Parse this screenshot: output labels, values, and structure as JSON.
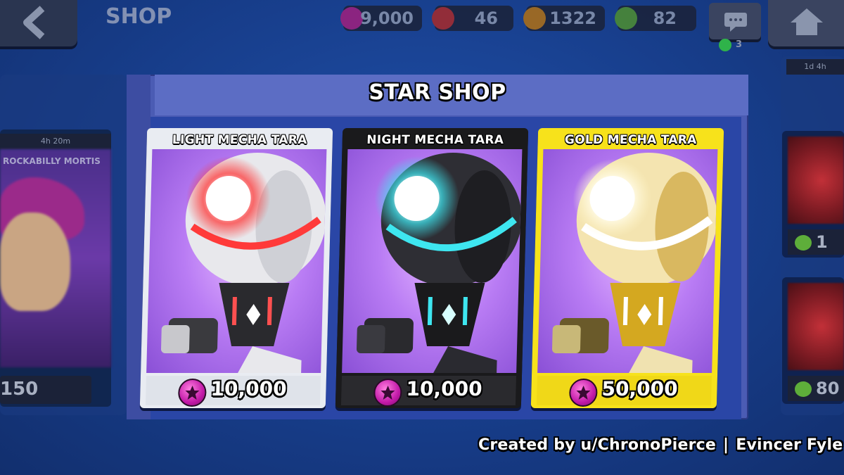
{
  "topbar": {
    "title": "SHOP",
    "currencies": [
      {
        "icon": "star-points-icon",
        "value": "9,000",
        "color": "#c2289a"
      },
      {
        "icon": "gem-red-icon",
        "value": "46",
        "color": "#c83232"
      },
      {
        "icon": "coin-icon",
        "value": "1322",
        "color": "#d08a18"
      },
      {
        "icon": "gem-green-icon",
        "value": "82",
        "color": "#5eae3a"
      }
    ],
    "chat_count": "3"
  },
  "side_left": {
    "timer": "4h 20m",
    "name": "ROCKABILLY MORTIS",
    "price": "150"
  },
  "side_right": {
    "timer": "1d 4h",
    "prices": [
      "1",
      "80"
    ]
  },
  "panel": {
    "title": "STAR SHOP"
  },
  "offers": [
    {
      "name": "LIGHT MECHA TARA",
      "price": "10,000",
      "theme": "light",
      "accent": "#ff3030"
    },
    {
      "name": "NIGHT MECHA TARA",
      "price": "10,000",
      "theme": "night",
      "accent": "#3ee6f0"
    },
    {
      "name": "GOLD MECHA TARA",
      "price": "50,000",
      "theme": "gold",
      "accent": "#ffffff"
    }
  ],
  "credit": {
    "author": "Created by u/ChronoPierce",
    "separator": "|",
    "artist": "Evincer Fyle"
  }
}
